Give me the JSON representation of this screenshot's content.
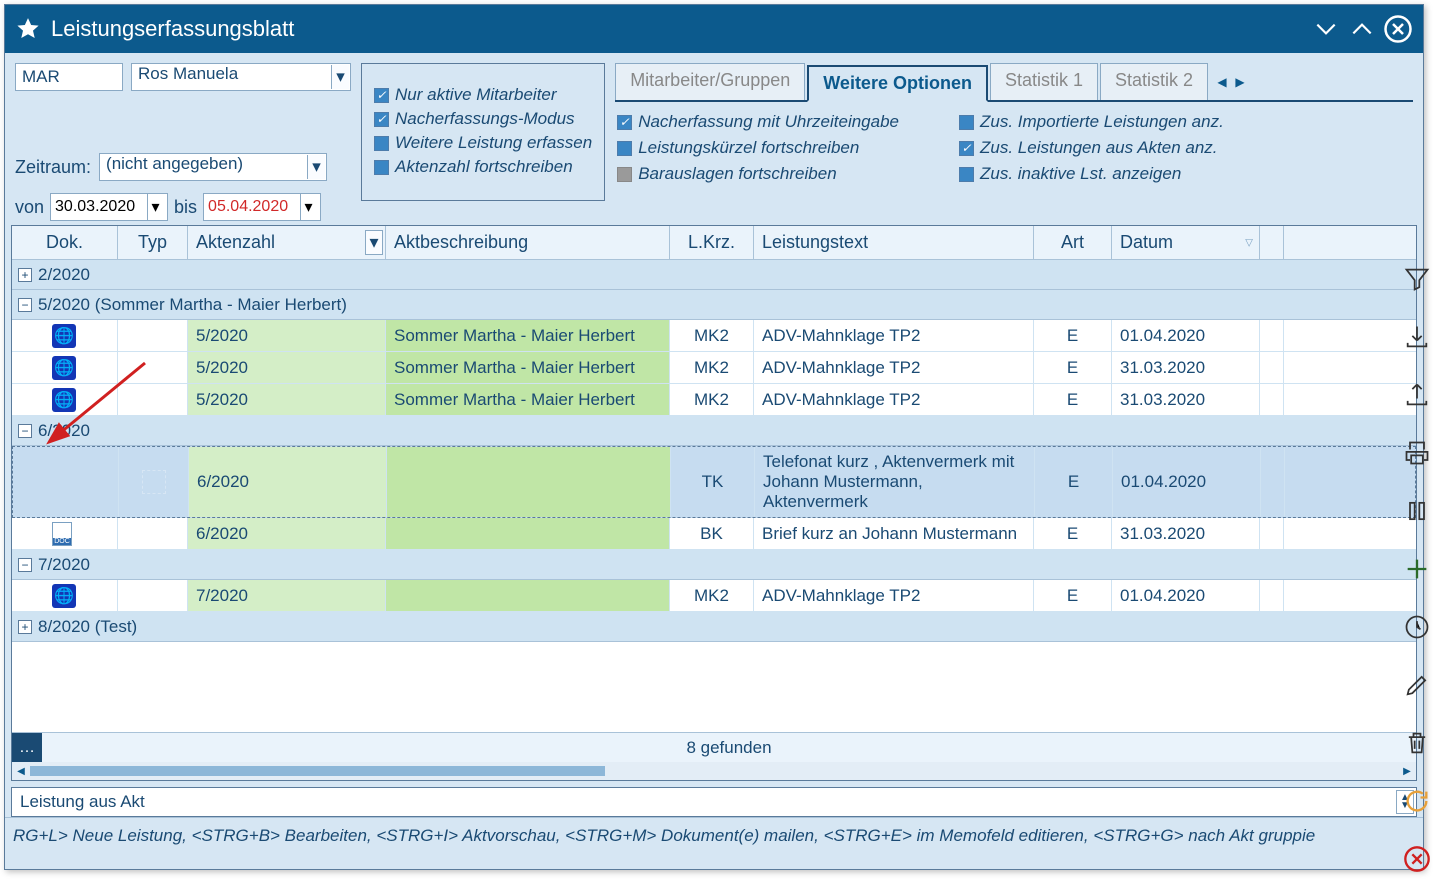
{
  "window": {
    "title": "Leistungserfassungsblatt"
  },
  "filter": {
    "code": "MAR",
    "name": "Ros Manuela",
    "period_label": "Zeitraum:",
    "period_value": "(nicht angegeben)",
    "from_label": "von",
    "from_value": "30.03.2020",
    "to_label": "bis",
    "to_value": "05.04.2020"
  },
  "options_left": [
    {
      "label": "Nur aktive Mitarbeiter",
      "state": "checked"
    },
    {
      "label": "Nacherfassungs-Modus",
      "state": "checked"
    },
    {
      "label": "Weitere Leistung erfassen",
      "state": "filled"
    },
    {
      "label": "Aktenzahl fortschreiben",
      "state": "filled"
    }
  ],
  "tabs": {
    "items": [
      "Mitarbeiter/Gruppen",
      "Weitere Optionen",
      "Statistik 1",
      "Statistik 2"
    ],
    "active": 1
  },
  "tab_options": {
    "col1": [
      {
        "label": "Nacherfassung mit Uhrzeiteingabe",
        "state": "checked"
      },
      {
        "label": "Leistungskürzel fortschreiben",
        "state": "filled"
      },
      {
        "label": "Barauslagen fortschreiben",
        "state": "grey"
      }
    ],
    "col2": [
      {
        "label": "Zus. Importierte Leistungen anz.",
        "state": "filled"
      },
      {
        "label": "Zus. Leistungen aus Akten anz.",
        "state": "checked"
      },
      {
        "label": "Zus. inaktive Lst. anzeigen",
        "state": "filled"
      }
    ]
  },
  "grid": {
    "headers": {
      "dok": "Dok.",
      "typ": "Typ",
      "az": "Aktenzahl",
      "ab": "Aktbeschreibung",
      "lk": "L.Krz.",
      "lt": "Leistungstext",
      "art": "Art",
      "dat": "Datum"
    },
    "groups": [
      {
        "expanded": false,
        "title": "2/2020",
        "rows": []
      },
      {
        "expanded": true,
        "title": "5/2020 (Sommer Martha - Maier Herbert)",
        "rows": [
          {
            "sel": false,
            "dok": "globe",
            "az": "5/2020",
            "ab": "Sommer Martha - Maier Herbert",
            "lk": "MK2",
            "lt": "ADV-Mahnklage TP2",
            "art": "E",
            "dat": "01.04.2020"
          },
          {
            "sel": false,
            "dok": "globe",
            "az": "5/2020",
            "ab": "Sommer Martha - Maier Herbert",
            "lk": "MK2",
            "lt": "ADV-Mahnklage TP2",
            "art": "E",
            "dat": "31.03.2020"
          },
          {
            "sel": false,
            "dok": "globe",
            "az": "5/2020",
            "ab": "Sommer Martha - Maier Herbert",
            "lk": "MK2",
            "lt": "ADV-Mahnklage TP2",
            "art": "E",
            "dat": "31.03.2020"
          }
        ]
      },
      {
        "expanded": true,
        "title": "6/2020",
        "rows": [
          {
            "sel": true,
            "tall": true,
            "dok": "",
            "az": "6/2020",
            "ab": "",
            "lk": "TK",
            "lt": "Telefonat kurz , Aktenvermerk mit Johann Mustermann, Aktenvermerk",
            "art": "E",
            "dat": "01.04.2020"
          },
          {
            "sel": false,
            "dok": "doc",
            "az": "6/2020",
            "ab": "",
            "lk": "BK",
            "lt": "Brief kurz an Johann Mustermann",
            "art": "E",
            "dat": "31.03.2020"
          }
        ]
      },
      {
        "expanded": true,
        "title": "7/2020",
        "rows": [
          {
            "sel": false,
            "dok": "globe",
            "az": "7/2020",
            "ab": "",
            "lk": "MK2",
            "lt": "ADV-Mahnklage TP2",
            "art": "E",
            "dat": "01.04.2020"
          }
        ]
      },
      {
        "expanded": false,
        "title": "8/2020 (Test)",
        "rows": []
      }
    ],
    "footer_count": "8 gefunden"
  },
  "bottom_input": "Leistung aus Akt",
  "statusbar": "RG+L> Neue Leistung, <STRG+B> Bearbeiten, <STRG+I> Aktvorschau, <STRG+M> Dokument(e) mailen, <STRG+E> im Memofeld editieren, <STRG+G> nach Akt gruppie",
  "side_tools": [
    "filter",
    "import",
    "export",
    "print",
    "pause",
    "add",
    "clock",
    "edit",
    "delete",
    "refresh",
    "close"
  ]
}
